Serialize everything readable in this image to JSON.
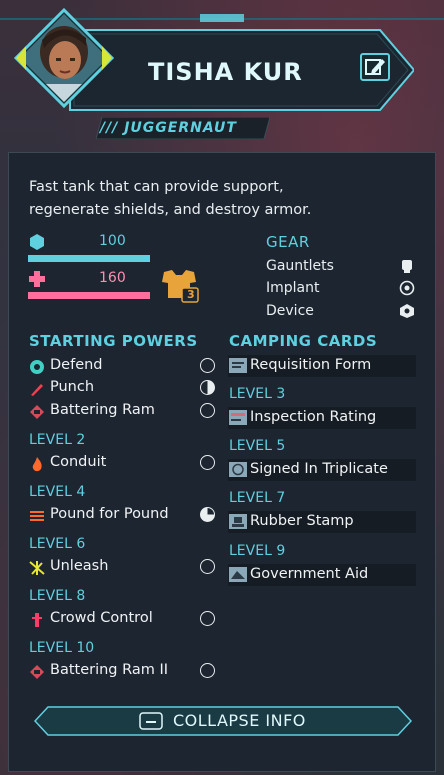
{
  "character": {
    "name": "TISHA KUR",
    "class": "/// JUGGERNAUT",
    "description_lines": [
      "Fast tank that can provide support,",
      "regenerate shields, and destroy armor."
    ]
  },
  "stats": {
    "shield_value": "100",
    "health_value": "160",
    "armor_badge": "3",
    "shield_color": "#5fd0e0",
    "health_color": "#ff6f9c",
    "armor_color": "#e8a33a"
  },
  "gear": {
    "title": "GEAR",
    "items": [
      {
        "label": "Gauntlets",
        "icon": "gauntlet-icon"
      },
      {
        "label": "Implant",
        "icon": "implant-icon"
      },
      {
        "label": "Device",
        "icon": "device-icon"
      }
    ]
  },
  "powers": {
    "title": "STARTING POWERS",
    "starting": [
      {
        "label": "Defend",
        "icon": "defend-icon"
      },
      {
        "label": "Punch",
        "icon": "punch-icon"
      },
      {
        "label": "Battering Ram",
        "icon": "battering-ram-icon"
      }
    ],
    "levels": [
      {
        "level": "LEVEL 2",
        "label": "Conduit",
        "icon": "conduit-icon"
      },
      {
        "level": "LEVEL 4",
        "label": "Pound for Pound",
        "icon": "pound-icon"
      },
      {
        "level": "LEVEL 6",
        "label": "Unleash",
        "icon": "unleash-icon"
      },
      {
        "level": "LEVEL 8",
        "label": "Crowd Control",
        "icon": "crowd-control-icon"
      },
      {
        "level": "LEVEL 10",
        "label": "Battering Ram II",
        "icon": "battering-ram-icon"
      }
    ]
  },
  "cards": {
    "title": "CAMPING CARDS",
    "starting": {
      "label": "Requisition Form"
    },
    "levels": [
      {
        "level": "LEVEL 3",
        "label": "Inspection Rating"
      },
      {
        "level": "LEVEL 5",
        "label": "Signed In Triplicate"
      },
      {
        "level": "LEVEL 7",
        "label": "Rubber Stamp"
      },
      {
        "level": "LEVEL 9",
        "label": "Government Aid"
      }
    ]
  },
  "footer": {
    "collapse_label": "COLLAPSE INFO"
  }
}
